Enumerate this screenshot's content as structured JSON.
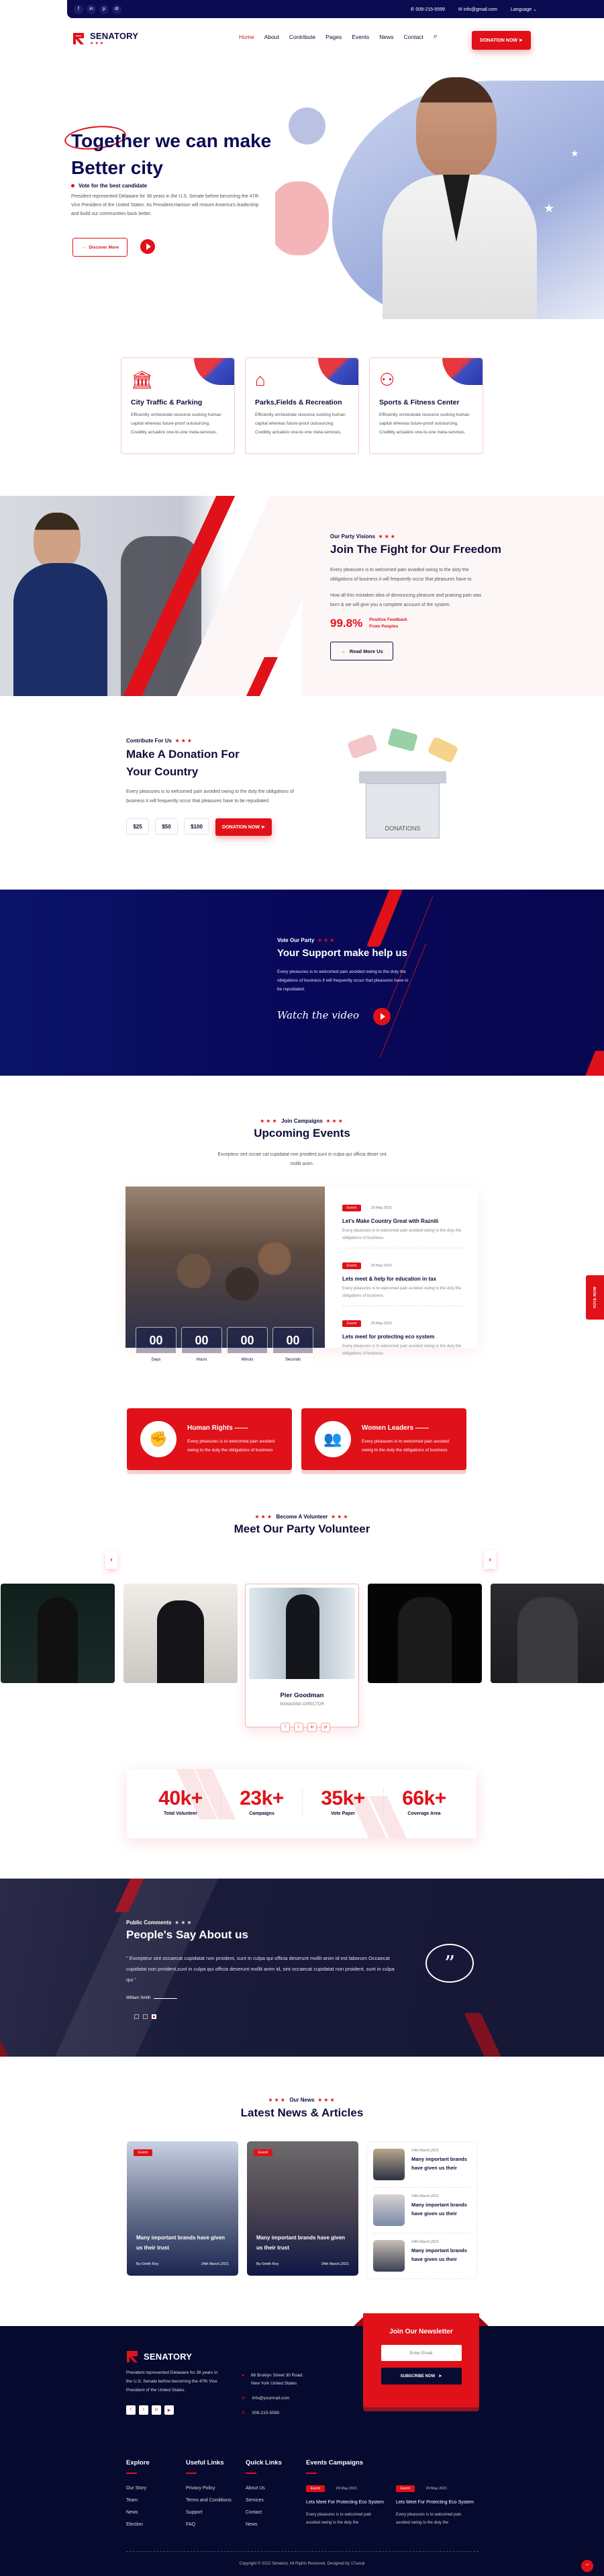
{
  "topbar": {
    "social": [
      "f",
      "in",
      "p",
      "dr"
    ],
    "social_icons": [
      "facebook-icon",
      "linkedin-icon",
      "pinterest-icon",
      "dribbble-icon"
    ],
    "phone": "009-215-5599",
    "email": "info@gmail.com",
    "language": "Language"
  },
  "header": {
    "brand": "SENATORY",
    "brand_stars": "★★★",
    "nav": [
      "Home",
      "About",
      "Contribute",
      "Pages",
      "Events",
      "News",
      "Contact"
    ],
    "active_nav": "Home",
    "cta": "DONATION NOW"
  },
  "hero": {
    "title_line1": "Together we can make",
    "title_line2": "Better city",
    "subtitle": "Vote for the best candidate",
    "text": "President represented Delaware for 36 years in the U.S. Senate before becoming the 47th Vice President of the United States. As President,Harison will restore America's leadership and build our communities back better.",
    "discover": "Discover More"
  },
  "services": [
    {
      "title": "City Traffic & Parking",
      "text": "Efficiently orchestrate resource sucking human capital whereas future-proof outsourcing. Credibly actualize one-to-one meta-services.",
      "icon": "city-hall-icon"
    },
    {
      "title": "Parks,Fields & Recreation",
      "text": "Efficiently orchestrate resource sucking human capital whereas future-proof outsourcing. Credibly actualize one-to-one meta-services.",
      "icon": "playground-icon"
    },
    {
      "title": "Sports & Fitness Center",
      "text": "Efficiently orchestrate resource sucking human capital whereas future-proof outsourcing. Credibly actualize one-to-one meta-services.",
      "icon": "dumbbell-icon"
    }
  ],
  "vision": {
    "label": "Our Party Visions",
    "title": "Join The Fight for Our Freedom",
    "p1": "Every pleasures is to welcomed pain avoided owing to the duty the obligations of business it will frequently occur that pleasures have to.",
    "p2": "How all this mistaken idea of denouncing pleasure and praising pain was born & we will give you a complete account of the system.",
    "percent": "99.8%",
    "percent_label1": "Positive Feedback",
    "percent_label2": "From Peoples",
    "button": "Read More Us"
  },
  "donation": {
    "label": "Contribute For Us",
    "title_line1": "Make A Donation For",
    "title_line2": "Your Country",
    "text": "Every pleasures is to welcomed pain avoided owing to the duty the obligations of business it will frequently occur that pleasures have to be repudiated.",
    "amounts": [
      "$25",
      "$50",
      "$100"
    ],
    "button": "DONATION NOW",
    "box_label": "DONATIONS"
  },
  "support": {
    "label": "Vote Our Party",
    "title": "Your Support make help us",
    "text": "Every pleasures is to welcomed pain avoided owing to the duty the obligations of business it will frequently occur that pleasures have to be repudiated.",
    "video": "Watch the video"
  },
  "events": {
    "label": "Join Campaigns",
    "title": "Upcoming Events",
    "text": "Excepteur sint occae cat cupidatat non proident,sunt in culpa qui officia deser unt mollit anim.",
    "countdown": [
      {
        "value": "00",
        "unit": "Days"
      },
      {
        "value": "00",
        "unit": "Hours"
      },
      {
        "value": "00",
        "unit": "Minuts"
      },
      {
        "value": "00",
        "unit": "Seconds"
      }
    ],
    "items": [
      {
        "tag": "Event",
        "date": "29 May 2021",
        "title": "Let's Make Country Great with Razniti",
        "text": "Every pleasures is to welcomed pain avoided owing to the duty the obligations of business."
      },
      {
        "tag": "Event",
        "date": "29 May 2021",
        "title": "Lets meet & help for education in tax",
        "text": "Every pleasures is to welcomed pain avoided owing to the duty the obligations of business."
      },
      {
        "tag": "Event",
        "date": "29 May 2021",
        "title": "Lets meet for protecting eco system",
        "text": "Every pleasures is to welcomed pain avoided owing to the duty the obligations of business."
      }
    ],
    "features": [
      {
        "title": "Human Rights",
        "text": "Every pleasures is to welcomed pain avoided owing to the duty the obligations of business",
        "icon": "raised-fists-icon"
      },
      {
        "title": "Women Leaders",
        "text": "Every pleasures is to welcomed pain avoided owing to the duty the obligations of business",
        "icon": "women-group-icon"
      }
    ]
  },
  "vote_tab": "VOTE NOW",
  "volunteers": {
    "label": "Become A Volunteer",
    "title": "Meet Our Party Volunteer",
    "featured_name": "Pier Goodman",
    "featured_role": "MANAGING DIRECTOR",
    "social": [
      "f",
      "t",
      "in",
      "yt"
    ],
    "social_icons": [
      "facebook-icon",
      "twitter-icon",
      "linkedin-icon",
      "youtube-icon"
    ]
  },
  "stats": [
    {
      "value": "40k+",
      "label": "Total Volunteer"
    },
    {
      "value": "23k+",
      "label": "Campaigns"
    },
    {
      "value": "35k+",
      "label": "Vote Paper"
    },
    {
      "value": "66k+",
      "label": "Coverage Area"
    }
  ],
  "testimonial": {
    "label": "Public Comments",
    "title": "People's Say About us",
    "quote": "\" Excepteur sint occaecat cupidatat non proident, sunt in culpa qui officia deserunt mollit anim id est laborum Occaecat cupidatat non proident,sunt in culpa qui officia deserunt mollit anim id, sint occaecat cupidatat non proident, sunt in culpa qui \"",
    "author": "William Smith",
    "active_dot": 3,
    "dot_count": 3
  },
  "news": {
    "label": "Our News",
    "title": "Latest News & Articles",
    "cards": [
      {
        "tag": "Event",
        "title": "Many important brands have given us their trust",
        "author": "By:Smith Roy",
        "date": "24th March,2021"
      },
      {
        "tag": "Event",
        "title": "Many important brands have given us their trust",
        "author": "By:Smith Roy",
        "date": "24th March,2021"
      }
    ],
    "mini": [
      {
        "date": "24th March,2021",
        "title": "Many important brands have given us their"
      },
      {
        "date": "24th March,2021",
        "title": "Many important brands have given us their"
      },
      {
        "date": "24th March,2021",
        "title": "Many important brands have given us their"
      }
    ]
  },
  "footer": {
    "brand": "SENATORY",
    "about": "President represented Delaware for 36 years in the U.S. Senate before becoming the 47th Vice President of the United States.",
    "address1": "66 Broklyn Street 30 Road.",
    "address2": "New York United States",
    "email": "info@yourmail.com",
    "phone": "009-215-5599",
    "newsletter_title": "Join Our Newsletter",
    "newsletter_placeholder": "Enter Email",
    "subscribe": "SUBSCRIBE NOW",
    "columns": [
      {
        "title": "Explore",
        "links": [
          "Our Story",
          "Team",
          "News",
          "Election"
        ]
      },
      {
        "title": "Useful Links",
        "links": [
          "Privacy Policy",
          "Terms and Conditions",
          "Support",
          "FAQ"
        ]
      },
      {
        "title": "Quick Links",
        "links": [
          "About Us",
          "Services",
          "Contact",
          "News"
        ]
      }
    ],
    "events_title": "Events Campaigns",
    "events": [
      {
        "tag": "Event",
        "date": "29 May 2021",
        "title": "Lets Meet For Protecting Eco System",
        "text": "Every pleasures is to welcomed pain avoided owing to the duty the"
      },
      {
        "tag": "Event",
        "date": "29 May 2021",
        "title": "Lets Meet For Protecting Eco System",
        "text": "Every pleasures is to welcomed pain avoided owing to the duty the"
      }
    ],
    "copyright": "Copyright © 2022 Senatory. All Rights Reserved. Designed by 17sucai"
  },
  "colors": {
    "brand_red": "#e01119",
    "brand_navy": "#0b0b52",
    "footer_bg": "#060a2e"
  }
}
